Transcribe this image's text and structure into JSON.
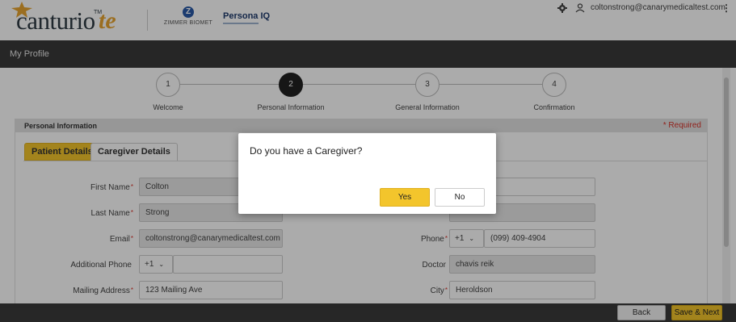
{
  "header": {
    "logo_main": "canturio",
    "logo_suffix": "te",
    "logo_tm": "TM",
    "partner_logo": "ZIMMER BIOMET",
    "partner_mark": "Z",
    "product_logo": "Persona IQ",
    "user_email": "coltonstrong@canarymedicaltest.com",
    "icons": [
      "gear-icon",
      "user-icon",
      "kebab-icon"
    ]
  },
  "page_title": "My Profile",
  "stepper": {
    "steps": [
      {
        "number": "1",
        "label": "Welcome",
        "active": false
      },
      {
        "number": "2",
        "label": "Personal Information",
        "active": true
      },
      {
        "number": "3",
        "label": "General Information",
        "active": false
      },
      {
        "number": "4",
        "label": "Confirmation",
        "active": false
      }
    ]
  },
  "section": {
    "title": "Personal Information",
    "required_note": "* Required"
  },
  "tabs": [
    {
      "label": "Patient Details",
      "active": true
    },
    {
      "label": "Caregiver Details",
      "active": false
    }
  ],
  "form": {
    "first_name": {
      "label": "First Name",
      "value": "Colton"
    },
    "last_name": {
      "label": "Last Name",
      "value": "Strong"
    },
    "email": {
      "label": "Email",
      "value": "coltonstrong@canarymedicaltest.com"
    },
    "additional_phone": {
      "label": "Additional Phone",
      "country_code": "+1",
      "value": ""
    },
    "mailing_address": {
      "label": "Mailing Address",
      "value": "123 Mailing Ave"
    },
    "phone": {
      "label": "Phone",
      "country_code": "+1",
      "value": "(099) 409-4904"
    },
    "doctor": {
      "label": "Doctor",
      "value": "chavis reik"
    },
    "city": {
      "label": "City",
      "value": "Heroldson"
    }
  },
  "footer": {
    "back_label": "Back",
    "save_next_label": "Save & Next"
  },
  "modal": {
    "question": "Do you have a Caregiver?",
    "yes_label": "Yes",
    "no_label": "No"
  },
  "colors": {
    "accent": "#f3c52c",
    "dark_bar": "#3a3a3a",
    "required": "#d9342b",
    "logo_orange": "#e8a530"
  }
}
